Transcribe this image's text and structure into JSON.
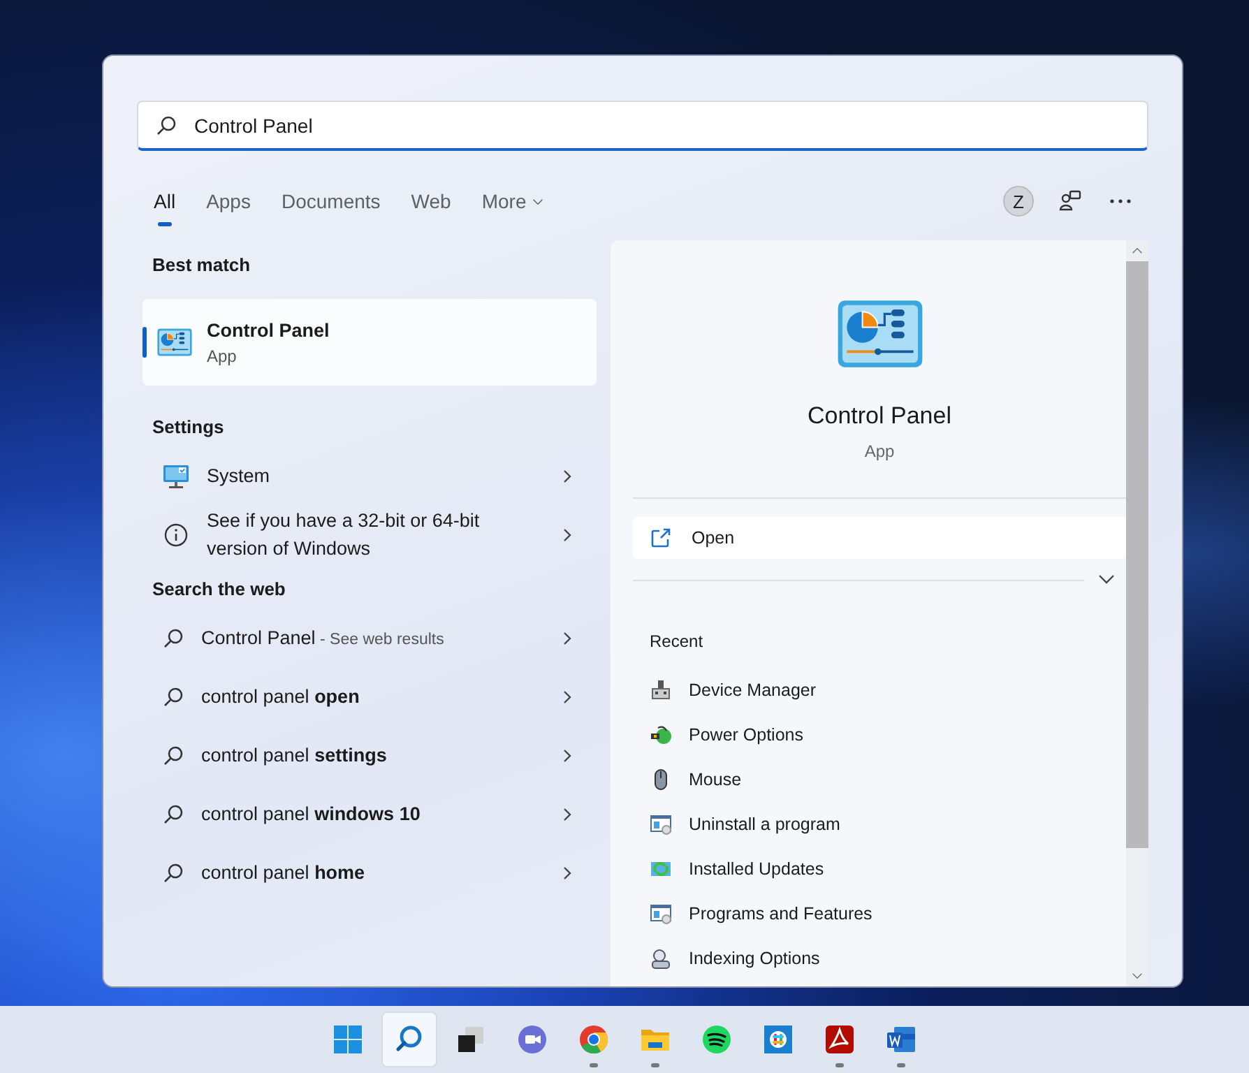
{
  "search": {
    "value": "Control Panel"
  },
  "tabs": [
    {
      "label": "All",
      "selected": true,
      "dropdown": false
    },
    {
      "label": "Apps",
      "selected": false,
      "dropdown": false
    },
    {
      "label": "Documents",
      "selected": false,
      "dropdown": false
    },
    {
      "label": "Web",
      "selected": false,
      "dropdown": false
    },
    {
      "label": "More",
      "selected": false,
      "dropdown": true
    }
  ],
  "account": {
    "initial": "Z"
  },
  "best_match": {
    "heading": "Best match",
    "item": {
      "title": "Control Panel",
      "subtitle": "App",
      "selected": true
    }
  },
  "settings": {
    "heading": "Settings",
    "items": [
      {
        "kind": "monitor",
        "label": "System"
      },
      {
        "kind": "info",
        "label": "See if you have a 32-bit or 64-bit version of Windows"
      }
    ]
  },
  "web": {
    "heading": "Search the web",
    "items": [
      {
        "text": "Control Panel",
        "note": "- See web results"
      },
      {
        "text": "control panel **open**"
      },
      {
        "text": "control panel **settings**"
      },
      {
        "text": "control panel **windows 10**"
      },
      {
        "text": "control panel **home**"
      }
    ]
  },
  "preview": {
    "title": "Control Panel",
    "subtitle": "App",
    "action": {
      "label": "Open"
    },
    "recent_heading": "Recent",
    "recent": [
      {
        "kind": "device",
        "label": "Device Manager"
      },
      {
        "kind": "power",
        "label": "Power Options"
      },
      {
        "kind": "mouse",
        "label": "Mouse"
      },
      {
        "kind": "programs",
        "label": "Uninstall a program"
      },
      {
        "kind": "updates",
        "label": "Installed Updates"
      },
      {
        "kind": "programs",
        "label": "Programs and Features"
      },
      {
        "kind": "indexing",
        "label": "Indexing Options"
      }
    ]
  },
  "taskbar": [
    {
      "kind": "start",
      "active": false,
      "running": false
    },
    {
      "kind": "search",
      "active": true,
      "running": false
    },
    {
      "kind": "taskview",
      "active": false,
      "running": false
    },
    {
      "kind": "chat",
      "active": false,
      "running": false
    },
    {
      "kind": "chrome",
      "active": false,
      "running": true
    },
    {
      "kind": "folder",
      "active": false,
      "running": true
    },
    {
      "kind": "music",
      "active": false,
      "running": false
    },
    {
      "kind": "slack",
      "active": false,
      "running": false
    },
    {
      "kind": "pdf",
      "active": false,
      "running": true
    },
    {
      "kind": "word",
      "active": false,
      "running": true
    }
  ]
}
